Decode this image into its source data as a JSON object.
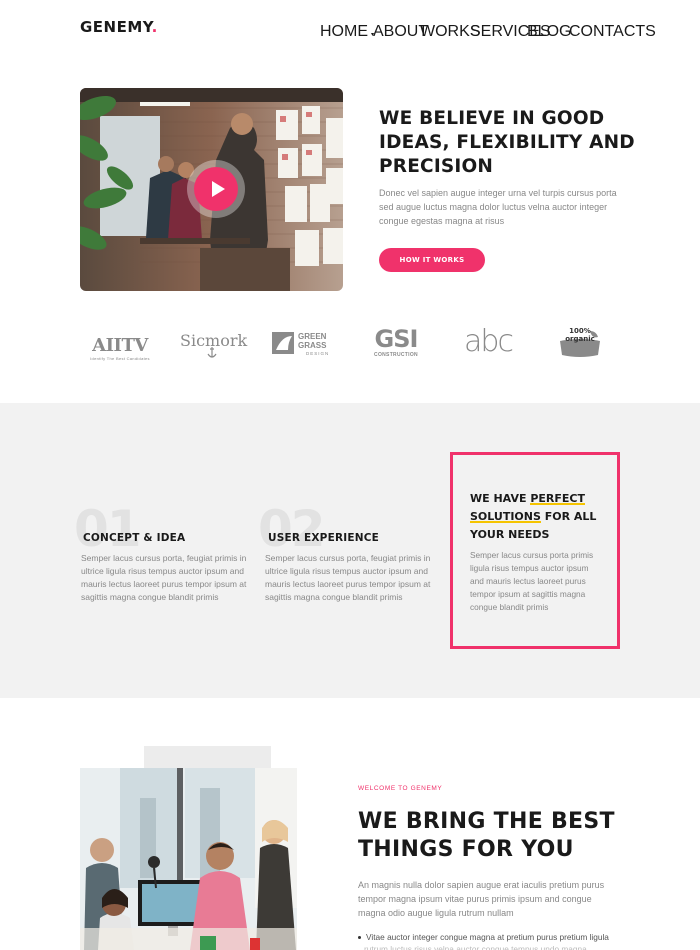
{
  "brand": {
    "name": "GENEMY",
    "dot": ".",
    "accent": "#f0326b"
  },
  "nav": {
    "items": [
      {
        "label": "HOME",
        "caret": "▾"
      },
      {
        "label": "ABOUT"
      },
      {
        "label": "WORKS"
      },
      {
        "label": "SERVICES"
      },
      {
        "label": "BLOG"
      },
      {
        "label": "CONTACTS"
      }
    ]
  },
  "hero": {
    "title": "WE BELIEVE IN GOOD IDEAS, FLEXIBILITY AND PRECISION",
    "text": "Donec vel sapien augue integer urna vel turpis cursus porta sed augue luctus magna dolor luctus velna auctor integer congue egestas magna at risus",
    "button": "HOW IT WORKS",
    "play_icon": "play-icon"
  },
  "logos": [
    {
      "name": "AIITV",
      "sub": "Identify The Best Candidates"
    },
    {
      "name": "Sicmork",
      "sub": ""
    },
    {
      "name": "GREEN GRASS",
      "sub": "DESIGN"
    },
    {
      "name": "GSI",
      "sub": "CONSTRUCTION"
    },
    {
      "name": "abc",
      "sub": ""
    },
    {
      "name": "100% organic",
      "sub": ""
    }
  ],
  "features": [
    {
      "num": "01",
      "title": "CONCEPT & IDEA",
      "text": "Semper lacus cursus porta, feugiat primis in ultrice ligula risus tempus auctor ipsum and mauris lectus laoreet purus tempor ipsum at sagittis magna congue blandit primis"
    },
    {
      "num": "02",
      "title": "USER EXPERIENCE",
      "text": "Semper lacus cursus porta, feugiat primis in ultrice ligula risus tempus auctor ipsum and mauris lectus laoreet purus tempor ipsum at sagittis magna congue blandit primis"
    }
  ],
  "highlight_box": {
    "title_a": "WE HAVE ",
    "title_b": "PERFECT",
    "title_c": "SOLUTIONS",
    "title_d": " FOR ALL YOUR NEEDS",
    "text": "Semper lacus cursus porta primis ligula risus tempus auctor ipsum and mauris lectus laoreet purus tempor ipsum at sagittis magna congue blandit primis",
    "border_color": "#f0326b",
    "underline_color": "#f5c400"
  },
  "about": {
    "eyebrow": "WELCOME TO GENEMY",
    "title": "WE BRING THE BEST THINGS FOR YOU",
    "text": "An magnis nulla dolor sapien augue erat iaculis pretium purus tempor magna ipsum vitae purus primis ipsum and congue magna odio augue ligula rutrum nullam",
    "bullet": "Vitae auctor integer congue magna at pretium purus pretium ligula",
    "bullet_cont": "rutrum luctus risus velna auctor congue tempus undo magna"
  }
}
